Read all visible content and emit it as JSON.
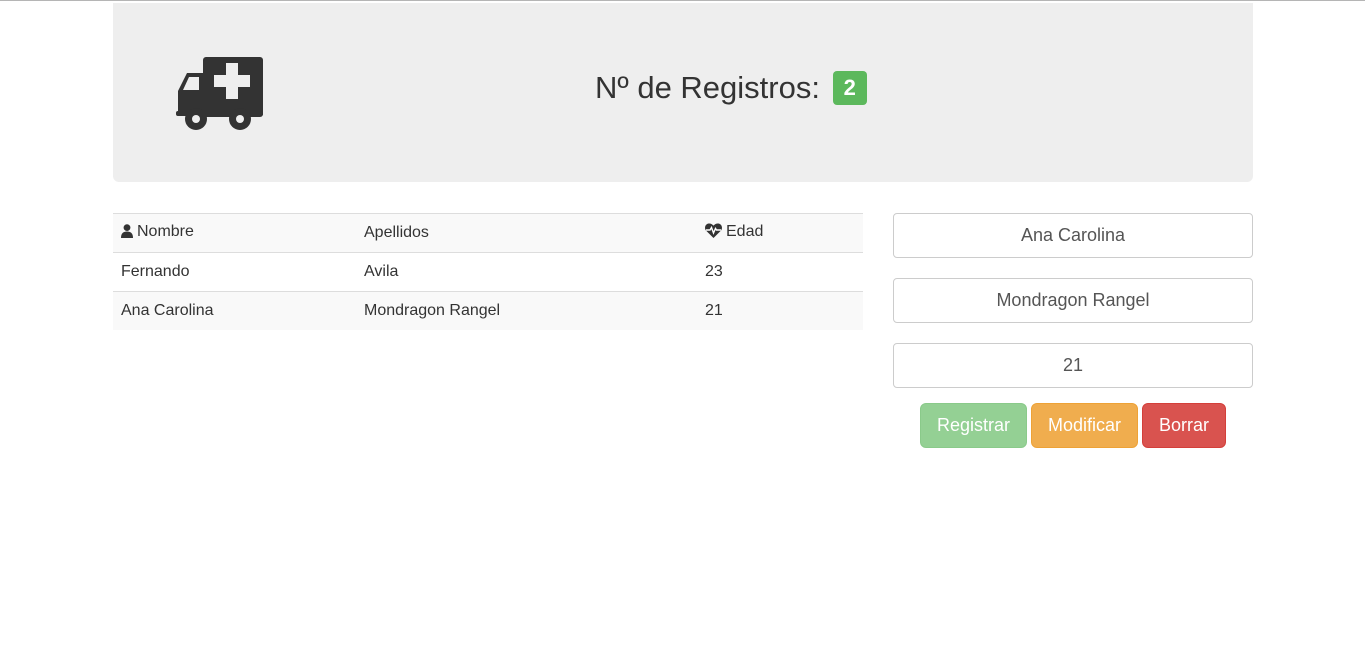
{
  "header": {
    "icon": "ambulance-icon",
    "title": "Nº de Registros:",
    "count": "2",
    "badge_color": "#5cb85c"
  },
  "table": {
    "columns": [
      {
        "label": "Nombre",
        "icon": "user-icon"
      },
      {
        "label": "Apellidos",
        "icon": null
      },
      {
        "label": "Edad",
        "icon": "heartbeat-icon"
      }
    ],
    "rows": [
      {
        "nombre": "Fernando",
        "apellidos": "Avila",
        "edad": "23"
      },
      {
        "nombre": "Ana Carolina",
        "apellidos": "Mondragon Rangel",
        "edad": "21"
      }
    ]
  },
  "form": {
    "nombre_value": "Ana Carolina",
    "apellidos_value": "Mondragon Rangel",
    "edad_value": "21"
  },
  "buttons": {
    "registrar": "Registrar",
    "modificar": "Modificar",
    "borrar": "Borrar"
  },
  "colors": {
    "success": "#5cb85c",
    "warning": "#f0ad4e",
    "danger": "#d9534f",
    "jumbotron_bg": "#eeeeee"
  }
}
